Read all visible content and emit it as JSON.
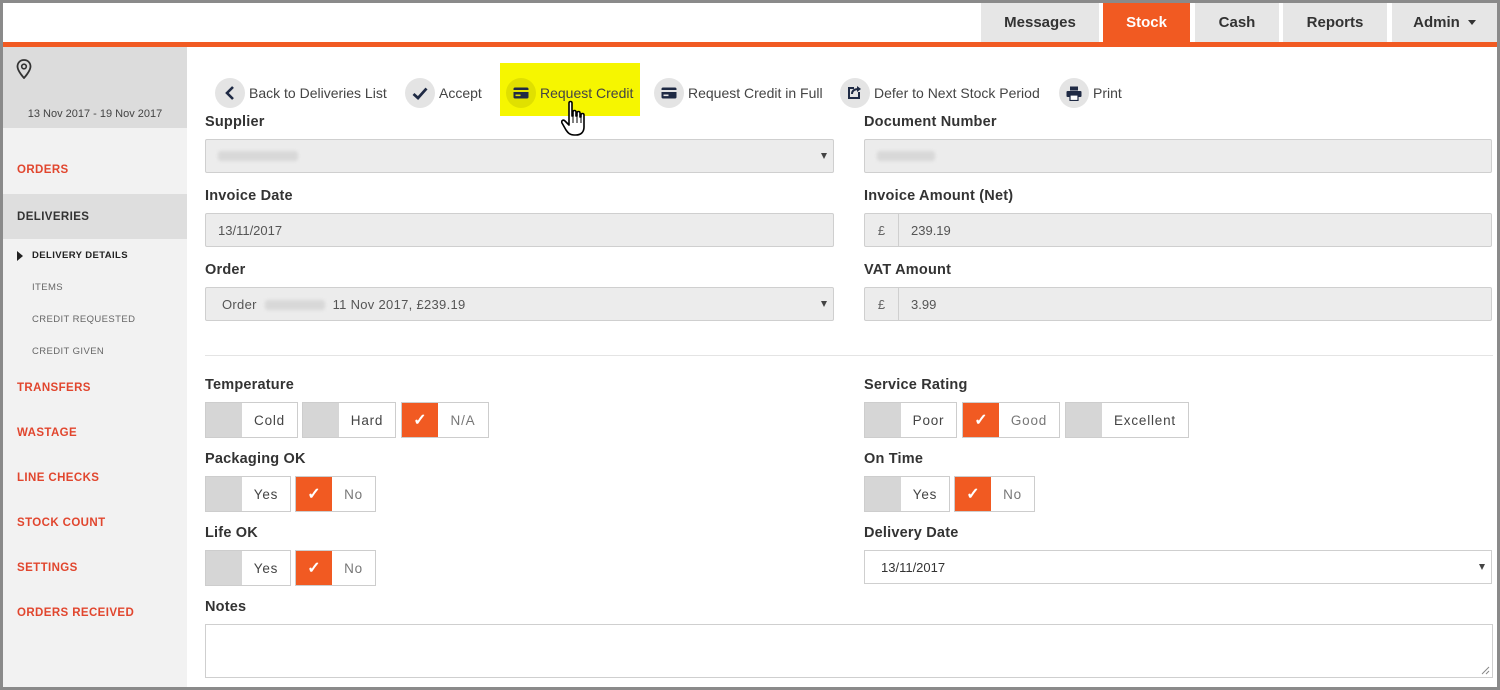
{
  "nav": {
    "tabs": [
      {
        "label": "Messages"
      },
      {
        "label": "Stock"
      },
      {
        "label": "Cash"
      },
      {
        "label": "Reports"
      },
      {
        "label": "Admin"
      }
    ],
    "accent": "#f15a22"
  },
  "sidebar": {
    "date_range": "13 Nov 2017 - 19 Nov 2017",
    "items": {
      "orders": "ORDERS",
      "deliveries": "DELIVERIES",
      "transfers": "TRANSFERS",
      "wastage": "WASTAGE",
      "line_checks": "LINE CHECKS",
      "stock_count": "STOCK COUNT",
      "settings": "SETTINGS",
      "orders_received": "ORDERS RECEIVED"
    },
    "sub_items": {
      "delivery_details": "DELIVERY DETAILS",
      "items": "ITEMS",
      "credit_requested": "CREDIT REQUESTED",
      "credit_given": "CREDIT GIVEN"
    }
  },
  "actions": {
    "back": "Back to Deliveries List",
    "accept": "Accept",
    "request_credit": "Request Credit",
    "request_credit_full": "Request Credit in Full",
    "defer": "Defer to Next Stock Period",
    "print": "Print"
  },
  "form": {
    "supplier_label": "Supplier",
    "document_number_label": "Document Number",
    "invoice_date_label": "Invoice Date",
    "invoice_date": "13/11/2017",
    "invoice_amount_label": "Invoice Amount (Net)",
    "currency": "£",
    "invoice_amount": "239.19",
    "order_label": "Order",
    "order_prefix": "Order",
    "order_suffix": "11 Nov 2017, £239.19",
    "vat_label": "VAT Amount",
    "vat_amount": "3.99",
    "temperature_label": "Temperature",
    "temperature_options": [
      "Cold",
      "Hard",
      "N/A"
    ],
    "service_rating_label": "Service Rating",
    "service_rating_options": [
      "Poor",
      "Good",
      "Excellent"
    ],
    "packaging_label": "Packaging OK",
    "on_time_label": "On Time",
    "life_label": "Life OK",
    "yes": "Yes",
    "no": "No",
    "delivery_date_label": "Delivery Date",
    "delivery_date": "13/11/2017",
    "notes_label": "Notes",
    "selected": {
      "temperature": "N/A",
      "service_rating": "Good",
      "packaging": "No",
      "on_time": "No",
      "life": "No"
    }
  }
}
